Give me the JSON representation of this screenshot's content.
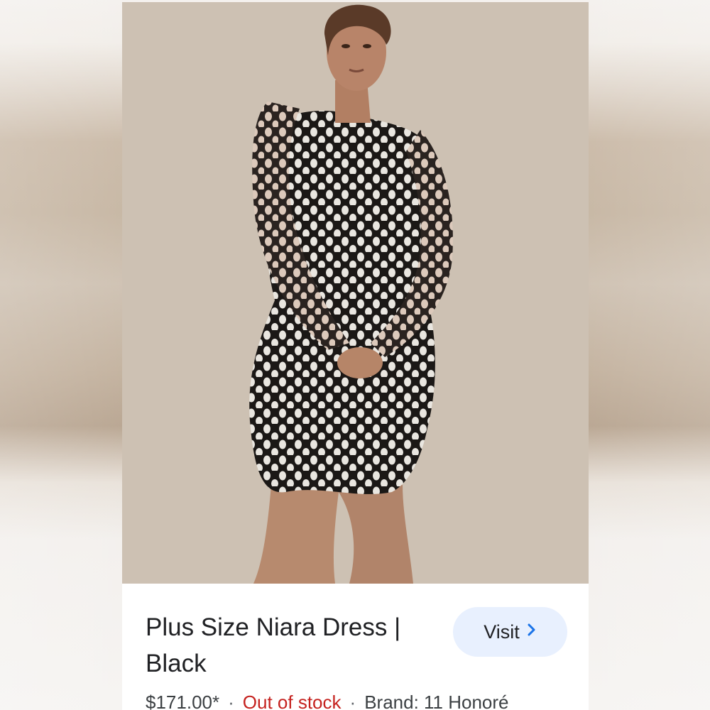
{
  "product": {
    "title_line1": "Plus Size Niara Dress |",
    "title_line2": "Black",
    "price": "$171.00*",
    "separator": "·",
    "stock_status": "Out of stock",
    "brand": "Brand: 11 Honoré"
  },
  "actions": {
    "visit_label": "Visit",
    "visit_icon": "chevron-right-icon"
  },
  "colors": {
    "visit_bg": "#e8f0fe",
    "chevron": "#1a73e8",
    "out_of_stock": "#c5221f",
    "title_text": "#202124"
  }
}
